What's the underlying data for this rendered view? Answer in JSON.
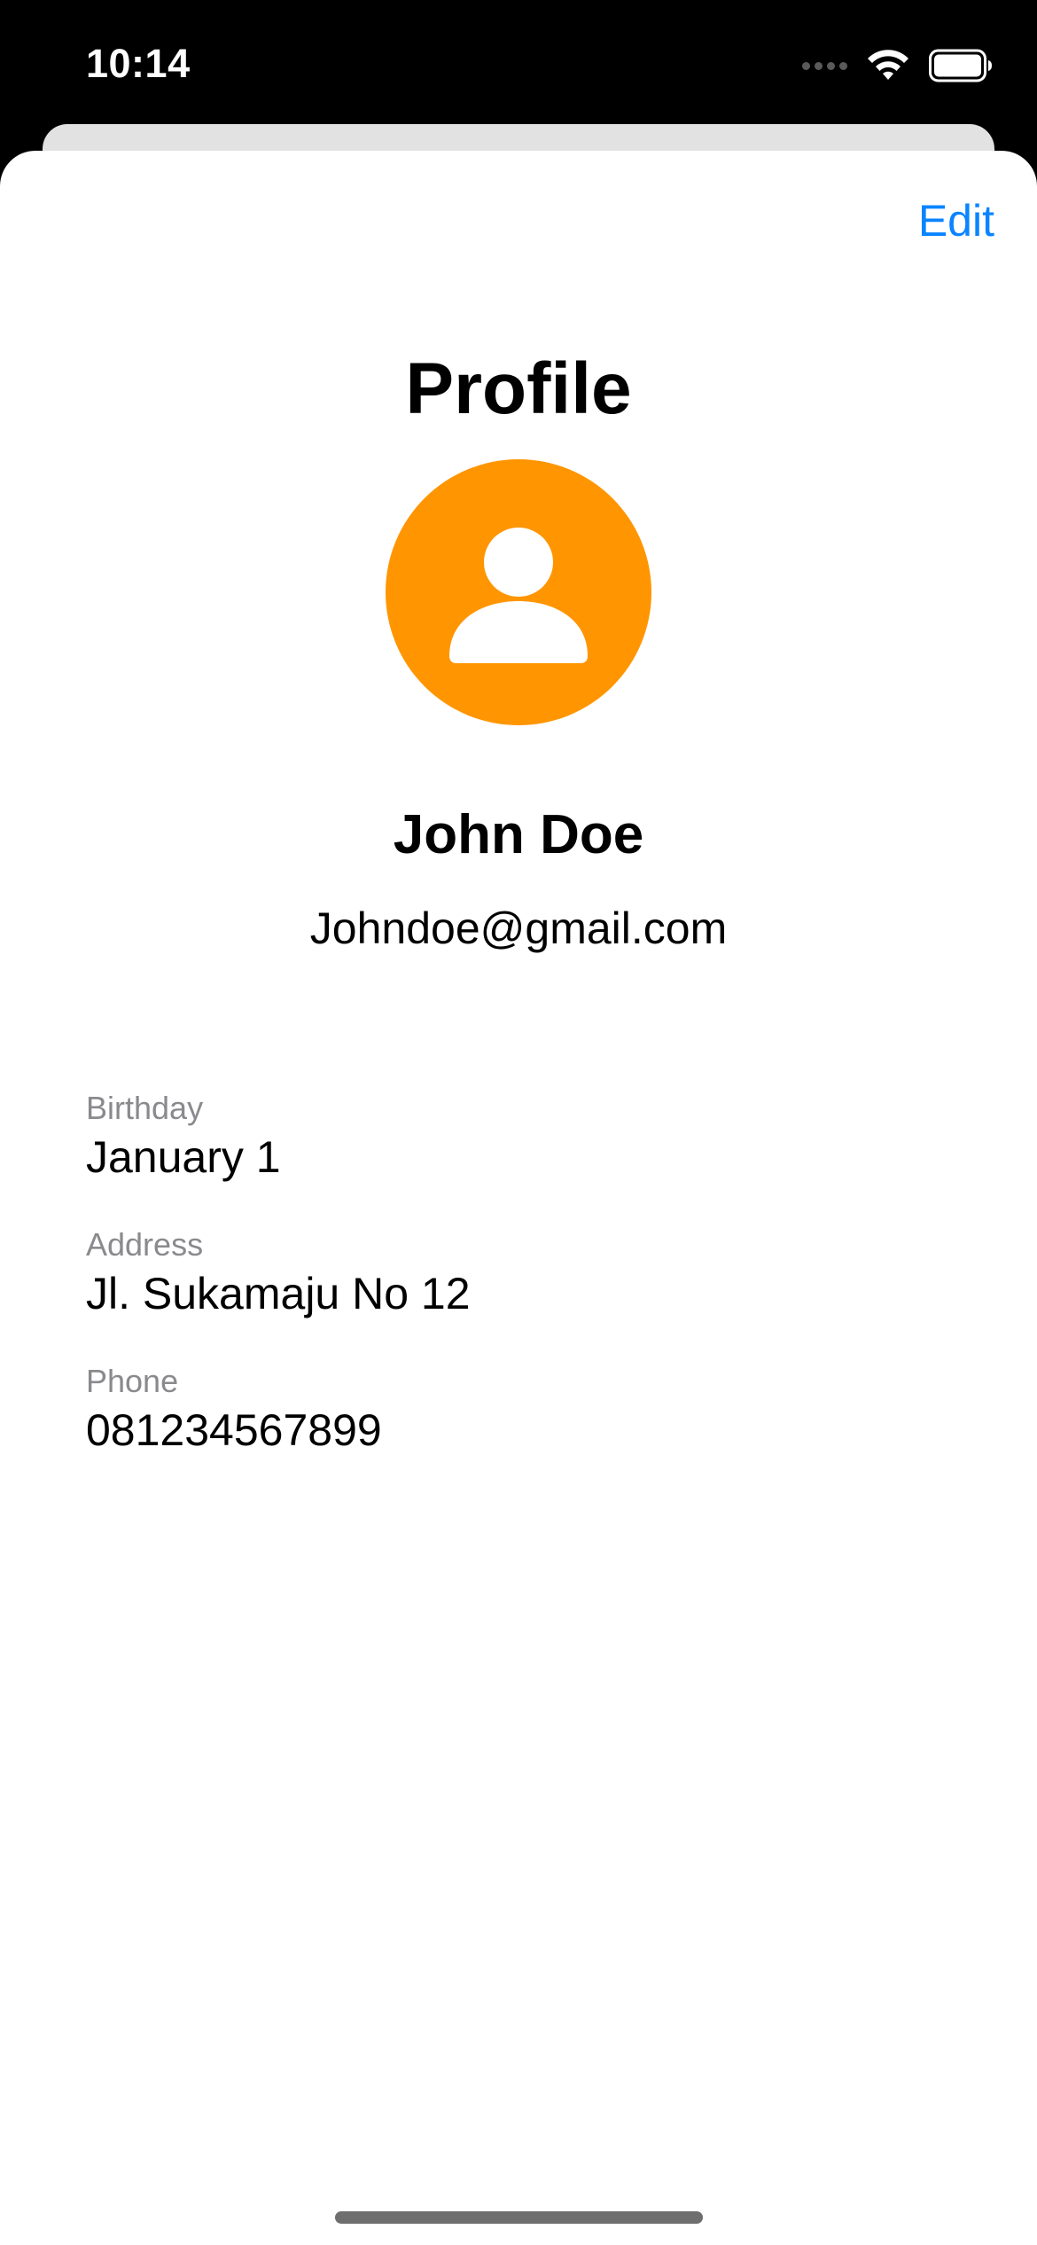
{
  "status_bar": {
    "time": "10:14",
    "wifi_icon": "wifi-icon",
    "battery_icon": "battery-icon"
  },
  "header": {
    "edit_label": "Edit",
    "accent_color": "#0a84ff"
  },
  "profile": {
    "title": "Profile",
    "avatar_icon": "person-icon",
    "avatar_color": "#ff9500",
    "name": "John Doe",
    "email": "Johndoe@gmail.com"
  },
  "fields": [
    {
      "label": "Birthday",
      "value": "January 1"
    },
    {
      "label": "Address",
      "value": "Jl. Sukamaju No 12"
    },
    {
      "label": "Phone",
      "value": "081234567899"
    }
  ]
}
